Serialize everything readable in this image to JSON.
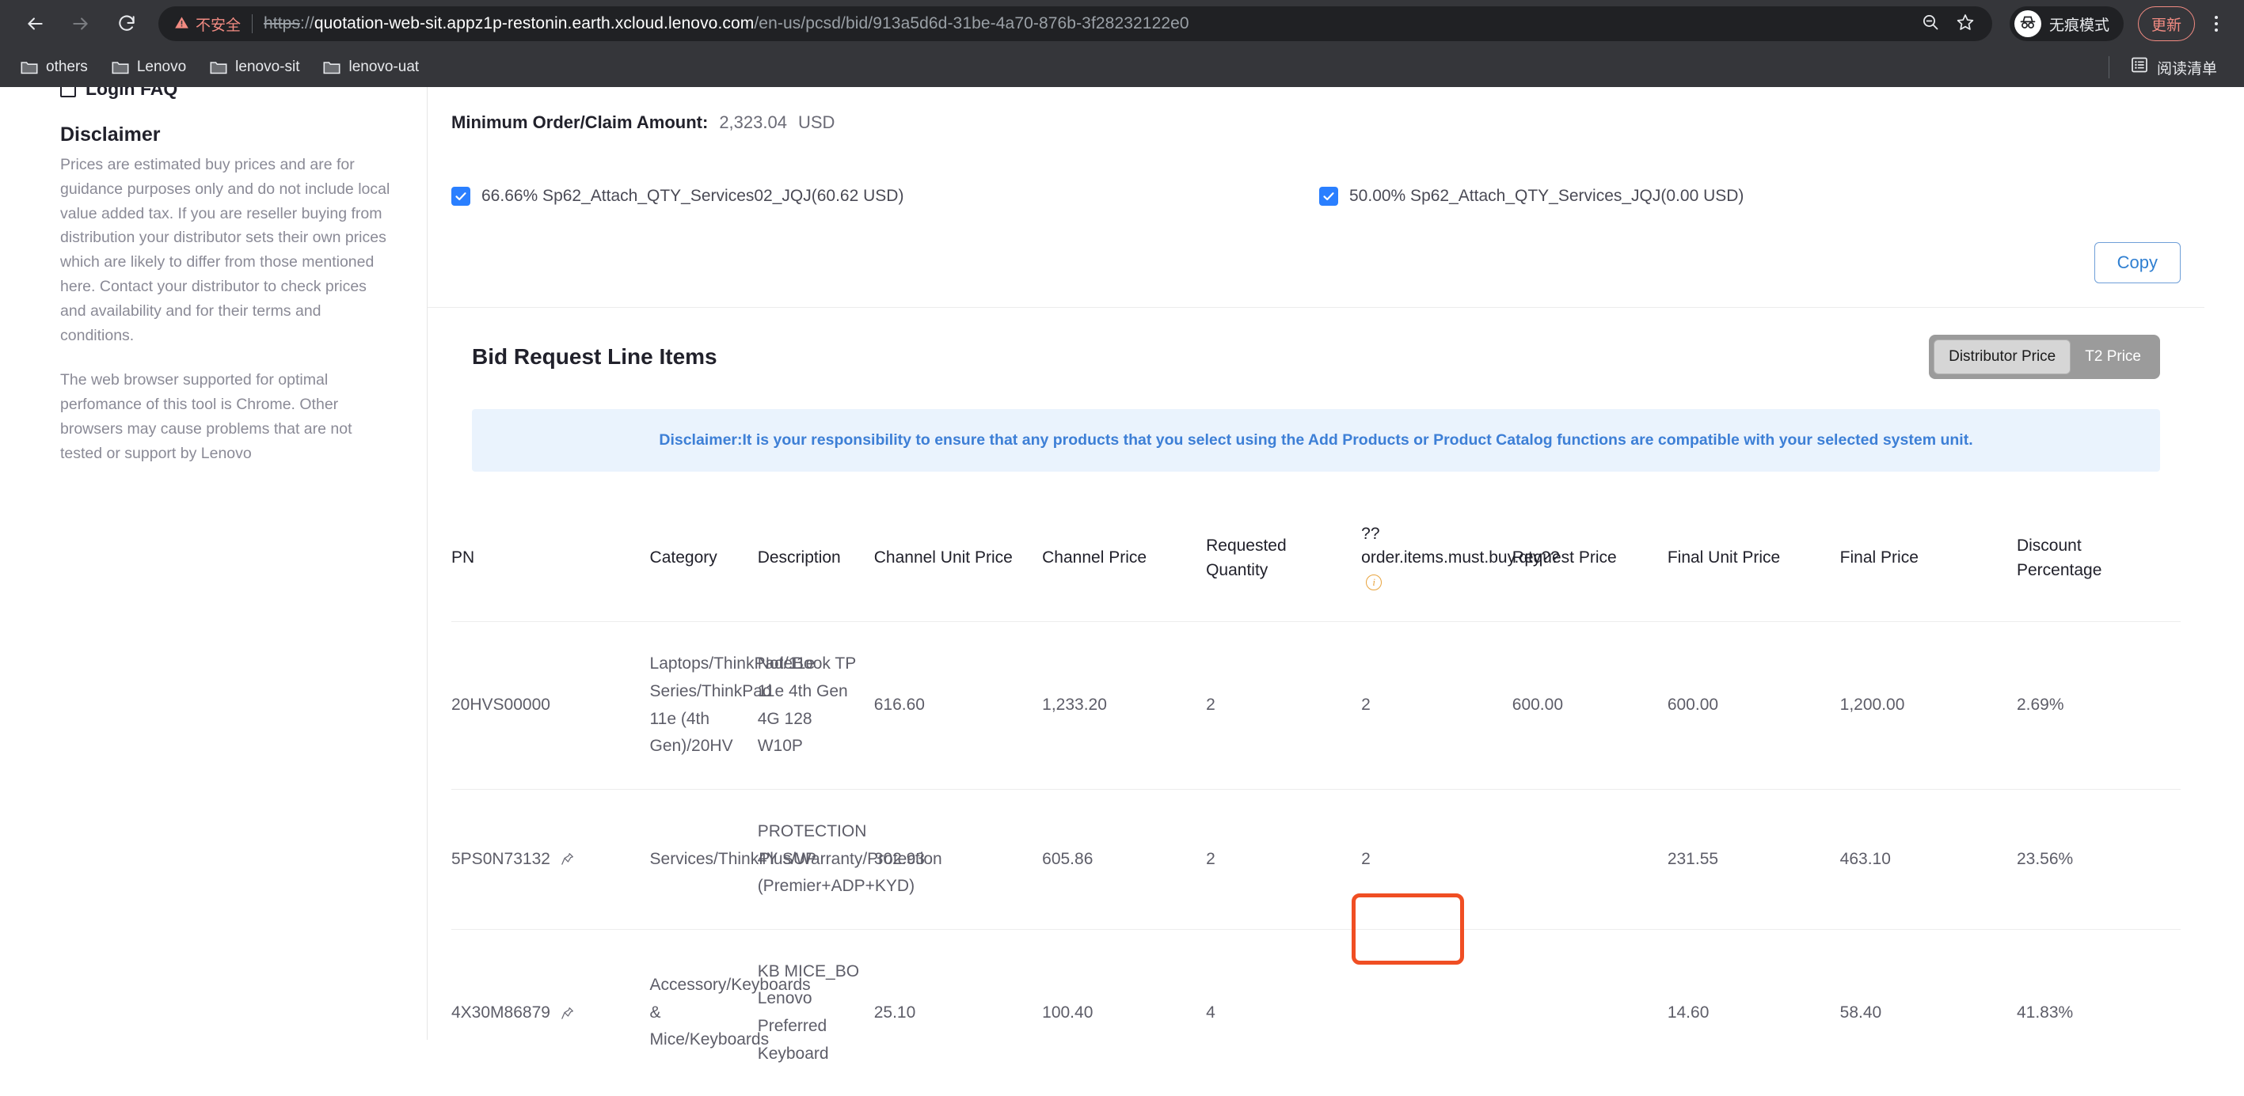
{
  "browser": {
    "back_icon": "back-arrow-icon",
    "forward_icon": "forward-arrow-icon",
    "reload_icon": "reload-icon",
    "security_warning": "不安全",
    "url_scheme": "https",
    "url_scheme_sep": "://",
    "url_host": "quotation-web-sit.appz1p-restonin.earth.xcloud.lenovo.com",
    "url_path": "/en-us/pcsd/bid/913a5d6d-31be-4a70-876b-3f28232122e0",
    "zoom_out_icon": "zoom-out-icon",
    "bookmark_star_icon": "star-icon",
    "incognito_label": "无痕模式",
    "update_label": "更新",
    "menu_icon": "kebab-menu-icon",
    "bookmarks": [
      {
        "label": "others"
      },
      {
        "label": "Lenovo"
      },
      {
        "label": "lenovo-sit"
      },
      {
        "label": "lenovo-uat"
      }
    ],
    "reading_list_label": "阅读清单"
  },
  "sidebar": {
    "login_faq": "Login FAQ",
    "disclaimer_title": "Disclaimer",
    "disclaimer_p1": "Prices are estimated buy prices and are for guidance purposes only and do not include local value added tax. If you are reseller buying from distribution your distributor sets their own prices which are likely to differ from those mentioned here. Contact your distributor to check prices and availability and for their terms and conditions.",
    "disclaimer_p2": "The web browser supported for optimal perfomance of this tool is Chrome. Other browsers may cause problems that are not tested or support by Lenovo"
  },
  "main": {
    "min_order_label": "Minimum Order/Claim Amount:",
    "min_order_value": "2,323.04",
    "min_order_currency": "USD",
    "attach_options": [
      {
        "label": "66.66% Sp62_Attach_QTY_Services02_JQJ(60.62 USD)",
        "checked": true
      },
      {
        "label": "50.00% Sp62_Attach_QTY_Services_JQJ(0.00 USD)",
        "checked": true
      }
    ],
    "copy_label": "Copy",
    "panel_title": "Bid Request Line Items",
    "segmented": {
      "options": [
        "Distributor Price",
        "T2 Price"
      ],
      "selected": "Distributor Price"
    },
    "banner_text": "Disclaimer:It is your responsibility to ensure that any products that you select using the Add Products or Product Catalog functions are compatible with your selected system unit.",
    "table": {
      "columns": [
        "PN",
        "Category",
        "Description",
        "Channel Unit Price",
        "Channel Price",
        "Requested Quantity",
        "?? order.items.must.buy.qty??",
        "Request Price",
        "Final Unit Price",
        "Final Price",
        "Discount Percentage"
      ],
      "must_buy_qty_info_icon": "info-icon",
      "rows": [
        {
          "pn": "20HVS00000",
          "pinned": false,
          "category": "Laptops/ThinkPad/11e Series/ThinkPad 11e (4th Gen)/20HV",
          "description": "NoteBook TP 11e 4th Gen 4G 128 W10P",
          "channel_unit_price": "616.60",
          "channel_price": "1,233.20",
          "requested_quantity": "2",
          "must_buy_qty": "2",
          "request_price": "600.00",
          "final_unit_price": "600.00",
          "final_price": "1,200.00",
          "discount_percentage": "2.69%"
        },
        {
          "pn": "5PS0N73132",
          "pinned": true,
          "category": "Services/ThinkPlus/Warranty/Protection",
          "description": "PROTECTION 4Y SUP (Premier+ADP+KYD)",
          "channel_unit_price": "302.93",
          "channel_price": "605.86",
          "requested_quantity": "2",
          "must_buy_qty": "2",
          "request_price": "",
          "final_unit_price": "231.55",
          "final_price": "463.10",
          "discount_percentage": "23.56%"
        },
        {
          "pn": "4X30M86879",
          "pinned": true,
          "category": "Accessory/Keyboards & Mice/Keyboards",
          "description": "KB MICE_BO Lenovo Preferred Keyboard",
          "channel_unit_price": "25.10",
          "channel_price": "100.40",
          "requested_quantity": "4",
          "must_buy_qty": "",
          "request_price": "",
          "final_unit_price": "14.60",
          "final_price": "58.40",
          "discount_percentage": "41.83%"
        }
      ]
    },
    "highlight": {
      "color": "#f04e23",
      "target": "must-buy-qty-cell-row-3"
    }
  }
}
